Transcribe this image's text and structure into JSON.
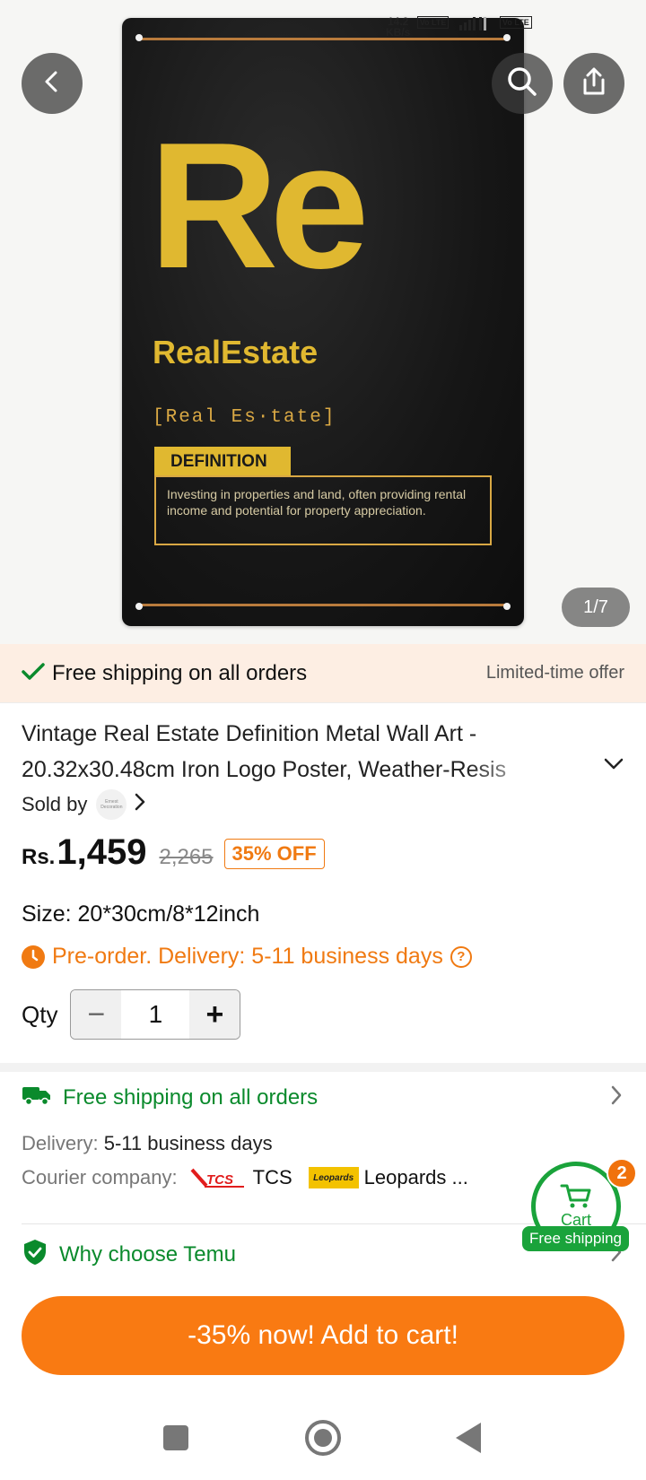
{
  "status_bar": {
    "speed": "14.2",
    "speed_unit": "KB/s",
    "net1": "Vo LTE",
    "net2": "Vo LTE"
  },
  "gallery": {
    "counter": "1/7",
    "poster": {
      "symbol": "Re",
      "word": "RealEstate",
      "phonetic": "[Real Es·tate]",
      "definition_label": "DEFINITION",
      "definition_text": "Investing in properties and land, often providing rental income and potential for property appreciation."
    }
  },
  "icons": {
    "back": "chevron-left-icon",
    "search": "search-icon",
    "share": "share-icon",
    "check": "check-icon",
    "truck": "truck-icon",
    "clock": "clock-icon",
    "help": "question-icon",
    "shield": "shield-check-icon",
    "cart": "cart-icon"
  },
  "banner": {
    "title": "Free shipping on all orders",
    "offer": "Limited-time offer"
  },
  "product": {
    "title": "Vintage Real Estate Definition Metal Wall Art - 20.32x30.48cm Iron Logo Poster, Weather-Resis",
    "sold_by_label": "Sold by",
    "seller_logo_text": "Ernest Decoration",
    "currency": "Rs.",
    "price": "1,459",
    "old_price": "2,265",
    "discount": "35% OFF",
    "size": "Size: 20*30cm/8*12inch",
    "preorder": "Pre-order. Delivery: 5-11 business days",
    "qty_label": "Qty",
    "qty_value": "1",
    "qty_minus": "−",
    "qty_plus": "+"
  },
  "shipping": {
    "title": "Free shipping on all orders",
    "delivery_label": "Delivery:",
    "delivery_value": "5-11 business days",
    "courier_label": "Courier company:",
    "courier_1": "TCS",
    "courier_2_logo": "Leopards",
    "courier_2": "Leopards ..."
  },
  "why": {
    "title": "Why choose Temu"
  },
  "cart": {
    "label": "Cart",
    "count": "2",
    "free_shipping": "Free shipping"
  },
  "cta": {
    "label": "-35% now! Add to cart!"
  },
  "colors": {
    "accent": "#f97a12",
    "green": "#0a8a2c",
    "poster_gold": "#e0b830"
  }
}
